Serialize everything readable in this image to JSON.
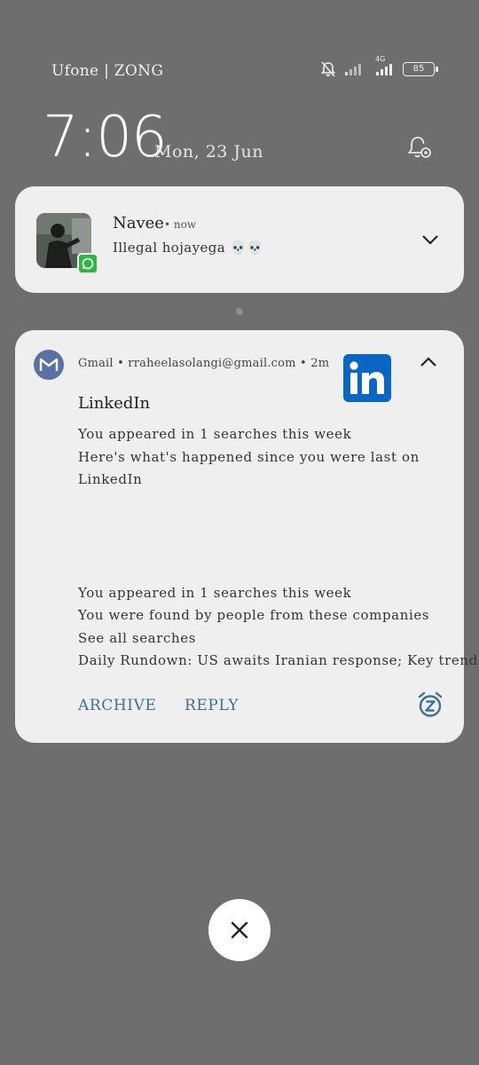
{
  "status_bar": {
    "carrier": "Ufone | ZONG",
    "network": "4G",
    "battery": "85"
  },
  "lockscreen": {
    "time": "7:06",
    "date": "Mon, 23 Jun"
  },
  "notifications": [
    {
      "app": "WhatsApp",
      "sender": "Navee",
      "time": "• now",
      "message": "Illegal hojayega 💀💀"
    },
    {
      "app": "Gmail",
      "header": "Gmail • rraheelasolangi@gmail.com • 2m",
      "subject": "LinkedIn",
      "lines": [
        "You appeared in 1 searches this week",
        "Here's what's happened since you were last on",
        "LinkedIn",
        "You appeared in 1 searches this week",
        "You were found by people from these companies",
        "See all searches",
        "Daily Rundown: US awaits Iranian response; Key trends"
      ],
      "actions": [
        "ARCHIVE",
        "REPLY"
      ]
    }
  ],
  "colors": {
    "background": "#6e6e6e",
    "card": "#efefef",
    "action": "#3f6f9a",
    "whatsapp": "#2fb44a",
    "gmail_icon": "#5a71a4",
    "linkedin": "#0a66c2"
  },
  "icons": [
    "bell-muted-icon",
    "signal-icon",
    "battery-icon",
    "notification-settings-icon",
    "chevron-down-icon",
    "chevron-up-icon",
    "whatsapp-icon",
    "gmail-icon",
    "linkedin-logo",
    "snooze-icon",
    "close-icon"
  ]
}
